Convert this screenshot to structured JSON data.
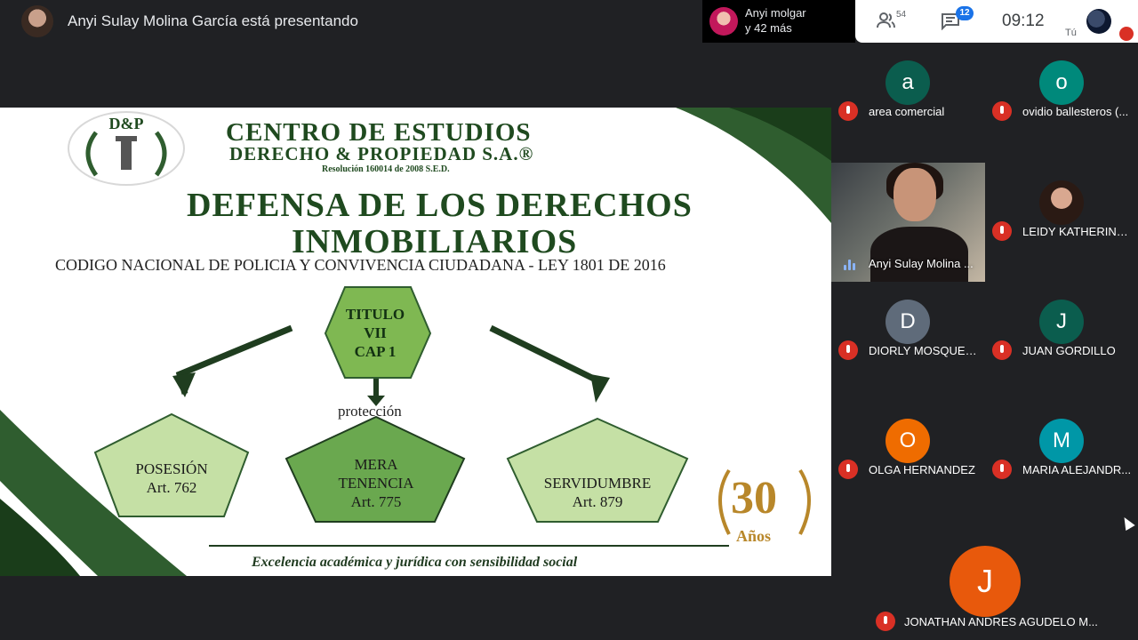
{
  "presentation_bar": {
    "presenter_text": "Anyi Sulay Molina García está presentando"
  },
  "others": {
    "line1": "Anyi molgar",
    "line2": "y 42 más"
  },
  "controls": {
    "people_count": "54",
    "chat_badge": "12",
    "clock": "09:12",
    "self_label": "Tú"
  },
  "slide": {
    "logo_text": "D&P",
    "org_line1": "CENTRO DE ESTUDIOS",
    "org_line2": "DERECHO & PROPIEDAD S.A.®",
    "resolution": "Resolución 160014 de 2008 S.E.D.",
    "title_line1": "DEFENSA DE LOS DERECHOS",
    "title_line2": "INMOBILIARIOS",
    "subtitle": "CODIGO NACIONAL DE POLICIA Y CONVIVENCIA CIUDADANA  - LEY 1801 DE 2016",
    "hex_lines": [
      "TITULO",
      "VII",
      "CAP 1"
    ],
    "middle_label": "protección",
    "left_box": [
      "POSESIÓN",
      "Art. 762"
    ],
    "center_box": [
      "MERA",
      "TENENCIA",
      "Art. 775"
    ],
    "right_box": [
      "SERVIDUMBRE",
      "Art. 879"
    ],
    "badge_number": "30",
    "badge_word": "Años",
    "footer": "Excelencia académica y jurídica con sensibilidad social"
  },
  "participants": [
    {
      "initial": "a",
      "name": "area comercial",
      "color": "#0b5d4e"
    },
    {
      "initial": "o",
      "name": "ovidio ballesteros (...",
      "color": "#00897b"
    },
    {
      "initial": "",
      "name": "Anyi Sulay Molina ...",
      "color": ""
    },
    {
      "initial": "",
      "name": "LEIDY KATHERINE ...",
      "color": ""
    },
    {
      "initial": "D",
      "name": "DIORLY MOSQUERA",
      "color": "#5f6b7a"
    },
    {
      "initial": "J",
      "name": "JUAN GORDILLO",
      "color": "#0b5d4e"
    },
    {
      "initial": "O",
      "name": "OLGA HERNANDEZ",
      "color": "#ef6c00"
    },
    {
      "initial": "M",
      "name": "MARIA ALEJANDR...",
      "color": "#0097a7"
    },
    {
      "initial": "J",
      "name": "JONATHAN ANDRES AGUDELO M...",
      "color": "#e8590c"
    }
  ]
}
